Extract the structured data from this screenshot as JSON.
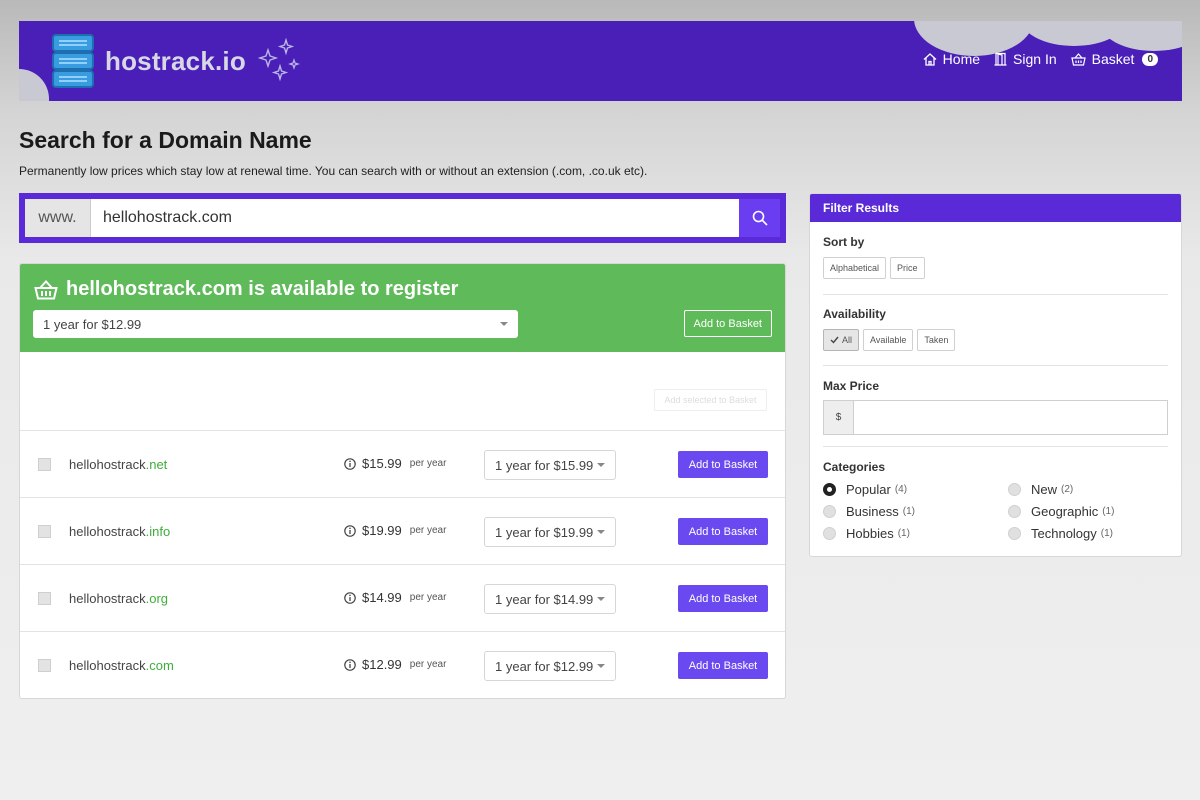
{
  "header": {
    "logo_text": "hostrack.io",
    "nav": {
      "home": "Home",
      "sign_in": "Sign In",
      "basket": "Basket",
      "basket_count": "0"
    }
  },
  "page": {
    "title": "Search for a Domain Name",
    "subtitle": "Permanently low prices which stay low at renewal time. You can search with or without an extension (.com, .co.uk etc)."
  },
  "search": {
    "prefix": "www.",
    "value": "hellohostrack.com"
  },
  "availability": {
    "headline": "hellohostrack.com is available to register",
    "term_option": "1 year for $12.99",
    "add_label": "Add to Basket",
    "bulk_label": "Add selected to Basket"
  },
  "results": [
    {
      "name": "hellohostrack",
      "ext": ".net",
      "price": "$15.99",
      "per": "per year",
      "term": "1 year for $15.99",
      "add": "Add to Basket"
    },
    {
      "name": "hellohostrack",
      "ext": ".info",
      "price": "$19.99",
      "per": "per year",
      "term": "1 year for $19.99",
      "add": "Add to Basket"
    },
    {
      "name": "hellohostrack",
      "ext": ".org",
      "price": "$14.99",
      "per": "per year",
      "term": "1 year for $14.99",
      "add": "Add to Basket"
    },
    {
      "name": "hellohostrack",
      "ext": ".com",
      "price": "$12.99",
      "per": "per year",
      "term": "1 year for $12.99",
      "add": "Add to Basket"
    }
  ],
  "filter": {
    "title": "Filter Results",
    "sort_label": "Sort by",
    "sort_options": [
      "Alphabetical",
      "Price"
    ],
    "availability_label": "Availability",
    "availability_options": [
      "All",
      "Available",
      "Taken"
    ],
    "max_price_label": "Max Price",
    "currency": "$",
    "categories_label": "Categories",
    "categories": [
      {
        "name": "Popular",
        "count": "(4)",
        "selected": true
      },
      {
        "name": "New",
        "count": "(2)",
        "selected": false
      },
      {
        "name": "Business",
        "count": "(1)",
        "selected": false
      },
      {
        "name": "Geographic",
        "count": "(1)",
        "selected": false
      },
      {
        "name": "Hobbies",
        "count": "(1)",
        "selected": false
      },
      {
        "name": "Technology",
        "count": "(1)",
        "selected": false
      }
    ]
  },
  "colors": {
    "brand_purple": "#4a1fb8",
    "accent_purple": "#6a4af0",
    "available_green": "#5fba5a",
    "extension_green": "#3dae3a"
  }
}
